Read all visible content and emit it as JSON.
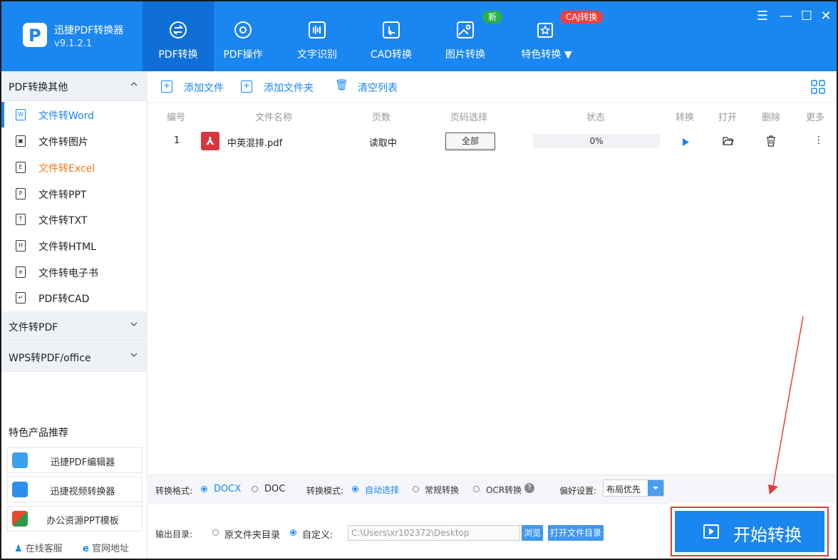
{
  "app": {
    "name": "迅捷PDF转换器",
    "version": "v9.1.2.1"
  },
  "tabs": [
    {
      "label": "PDF转换"
    },
    {
      "label": "PDF操作"
    },
    {
      "label": "文字识别"
    },
    {
      "label": "CAD转换"
    },
    {
      "label": "图片转换"
    },
    {
      "label": "特色转换 ▼"
    }
  ],
  "badges": {
    "new": "新",
    "caj": "CAJ转换"
  },
  "sidebar": {
    "section1": "PDF转换其他",
    "items": [
      {
        "label": "文件转Word",
        "icon_char": "W"
      },
      {
        "label": "文件转图片",
        "icon_char": "▣"
      },
      {
        "label": "文件转Excel",
        "icon_char": "E"
      },
      {
        "label": "文件转PPT",
        "icon_char": "P"
      },
      {
        "label": "文件转TXT",
        "icon_char": "T"
      },
      {
        "label": "文件转HTML",
        "icon_char": "H"
      },
      {
        "label": "文件转电子书",
        "icon_char": "e"
      },
      {
        "label": "PDF转CAD",
        "icon_char": "↵"
      }
    ],
    "section2": "文件转PDF",
    "section3": "WPS转PDF/office",
    "promo_title": "特色产品推荐",
    "promos": [
      {
        "label": "迅捷PDF编辑器"
      },
      {
        "label": "迅捷视频转换器"
      },
      {
        "label": "办公资源PPT模板"
      }
    ],
    "footer": {
      "service": "在线客服",
      "site": "官网地址"
    }
  },
  "toolbar": {
    "add_file": "添加文件",
    "add_folder": "添加文件夹",
    "clear": "清空列表"
  },
  "table": {
    "headers": {
      "num": "编号",
      "name": "文件名称",
      "pages": "页数",
      "page_select": "页码选择",
      "status": "状态",
      "convert": "转换",
      "open": "打开",
      "delete": "删除",
      "more": "更多"
    },
    "rows": [
      {
        "num": "1",
        "name": "中英混排.pdf",
        "pages": "读取中",
        "page_select": "全部",
        "progress": "0%",
        "progress_fraction": 0
      }
    ]
  },
  "options": {
    "format_label": "转换格式:",
    "format_docx": "DOCX",
    "format_doc": "DOC",
    "mode_label": "转换模式:",
    "mode_auto": "自动选择",
    "mode_normal": "常规转换",
    "mode_ocr": "OCR转换",
    "pref_label": "偏好设置:",
    "pref_value": "布局优先"
  },
  "output": {
    "label": "输出目录:",
    "orig": "原文件夹目录",
    "custom": "自定义:",
    "path": "C:\\Users\\xr102372\\Desktop",
    "browse": "浏览",
    "open_folder": "打开文件目录"
  },
  "start_button": "开始转换",
  "colors": {
    "brand": "#1a86f0",
    "active_tab": "#0f6fd6",
    "highlight": "#e83a3a",
    "excel_label": "#f07a1a"
  }
}
